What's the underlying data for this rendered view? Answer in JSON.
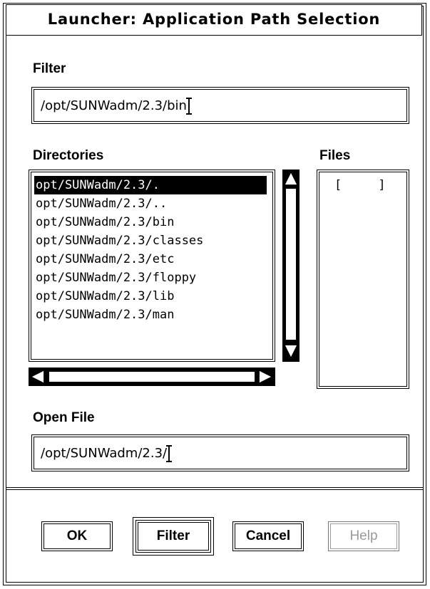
{
  "window": {
    "title": "Launcher: Application Path  Selection"
  },
  "filter": {
    "label": "Filter",
    "value": "/opt/SUNWadm/2.3/bin"
  },
  "directories": {
    "label": "Directories",
    "items": [
      "opt/SUNWadm/2.3/.",
      "opt/SUNWadm/2.3/..",
      "opt/SUNWadm/2.3/bin",
      "opt/SUNWadm/2.3/classes",
      "opt/SUNWadm/2.3/etc",
      "opt/SUNWadm/2.3/floppy",
      "opt/SUNWadm/2.3/lib",
      "opt/SUNWadm/2.3/man"
    ],
    "selected_index": 0
  },
  "files": {
    "label": "Files",
    "items": [
      "[     ]"
    ]
  },
  "open_file": {
    "label": "Open File",
    "value": "/opt/SUNWadm/2.3/"
  },
  "buttons": {
    "ok": "OK",
    "filter": "Filter",
    "cancel": "Cancel",
    "help": "Help"
  }
}
